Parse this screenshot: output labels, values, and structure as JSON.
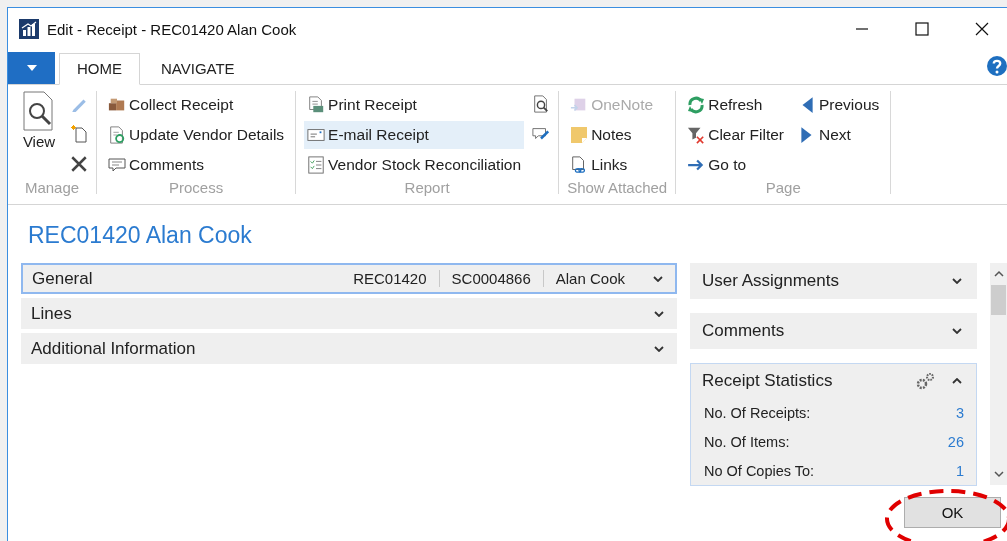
{
  "window": {
    "title": "Edit - Receipt - REC01420 Alan Cook"
  },
  "tabs": [
    {
      "label": "HOME",
      "selected": true
    },
    {
      "label": "NAVIGATE",
      "selected": false
    }
  ],
  "ribbon": {
    "groups": [
      {
        "label": "Manage",
        "columns": [
          [
            {
              "kind": "large",
              "label": "View"
            }
          ],
          [
            {
              "kind": "icon"
            },
            {
              "kind": "icon"
            },
            {
              "kind": "icon"
            }
          ]
        ]
      },
      {
        "label": "Process",
        "columns": [
          [
            {
              "kind": "small",
              "label": "Collect Receipt",
              "disabled": false,
              "highlighted": false
            },
            {
              "kind": "small",
              "label": "Update Vendor Details",
              "disabled": false,
              "highlighted": false
            },
            {
              "kind": "small",
              "label": "Comments",
              "disabled": false,
              "highlighted": false
            }
          ]
        ]
      },
      {
        "label": "Report",
        "columns": [
          [
            {
              "kind": "small",
              "label": "Print Receipt",
              "disabled": false,
              "highlighted": false
            },
            {
              "kind": "small",
              "label": "E-mail Receipt",
              "disabled": false,
              "highlighted": true
            },
            {
              "kind": "small",
              "label": "Vendor Stock Reconciliation",
              "disabled": false,
              "highlighted": false
            }
          ],
          [
            {
              "kind": "icon"
            },
            {
              "kind": "icon"
            }
          ]
        ]
      },
      {
        "label": "Show Attached",
        "columns": [
          [
            {
              "kind": "small",
              "label": "OneNote",
              "disabled": true,
              "highlighted": false
            },
            {
              "kind": "small",
              "label": "Notes",
              "disabled": false,
              "highlighted": false
            },
            {
              "kind": "small",
              "label": "Links",
              "disabled": false,
              "highlighted": false
            }
          ]
        ]
      },
      {
        "label": "Page",
        "columns": [
          [
            {
              "kind": "small",
              "label": "Refresh",
              "disabled": false,
              "highlighted": false
            },
            {
              "kind": "small",
              "label": "Clear Filter",
              "disabled": false,
              "highlighted": false
            },
            {
              "kind": "small",
              "label": "Go to",
              "disabled": false,
              "highlighted": false
            }
          ],
          [
            {
              "kind": "small",
              "label": "Previous",
              "disabled": false,
              "highlighted": false
            },
            {
              "kind": "small",
              "label": "Next",
              "disabled": false,
              "highlighted": false
            }
          ]
        ]
      }
    ]
  },
  "page_title": "REC01420 Alan Cook",
  "sections": [
    {
      "title": "General",
      "focused": true,
      "expanded": false,
      "summary": [
        "REC01420",
        "SC0004866",
        "Alan Cook"
      ]
    },
    {
      "title": "Lines",
      "focused": false,
      "expanded": false
    },
    {
      "title": "Additional Information",
      "focused": false,
      "expanded": false
    }
  ],
  "factboxes": [
    {
      "title": "User Assignments",
      "focused": false,
      "expanded": false
    },
    {
      "title": "Comments",
      "focused": false,
      "expanded": false
    },
    {
      "title": "Receipt Statistics",
      "focused": true,
      "expanded": true,
      "fields": [
        {
          "label": "No. Of Receipts:",
          "value": "3"
        },
        {
          "label": "No. Of Items:",
          "value": "26"
        },
        {
          "label": "No Of Copies To:",
          "value": "1"
        }
      ]
    }
  ],
  "ok_button": "OK"
}
